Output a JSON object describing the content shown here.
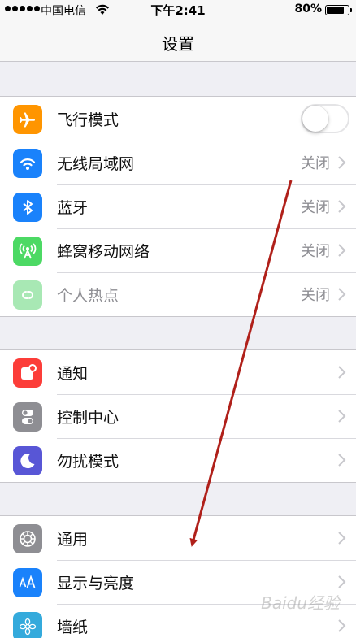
{
  "status_bar": {
    "carrier": "中国电信",
    "time": "下午2:41",
    "battery_percent": "80%",
    "battery_level": 0.8
  },
  "nav": {
    "title": "设置"
  },
  "groups": [
    {
      "items": [
        {
          "label": "飞行模式",
          "icon": "airplane-icon",
          "icon_color": "#ff9500",
          "control": "toggle",
          "toggle_on": false
        },
        {
          "label": "无线局域网",
          "icon": "wifi-icon",
          "icon_color": "#1a82fb",
          "value": "关闭"
        },
        {
          "label": "蓝牙",
          "icon": "bluetooth-icon",
          "icon_color": "#1a82fb",
          "value": "关闭"
        },
        {
          "label": "蜂窝移动网络",
          "icon": "cellular-icon",
          "icon_color": "#4cd964",
          "value": "关闭"
        },
        {
          "label": "个人热点",
          "icon": "hotspot-icon",
          "icon_color": "#a8e8b4",
          "value": "关闭",
          "disabled": true
        }
      ]
    },
    {
      "items": [
        {
          "label": "通知",
          "icon": "notifications-icon",
          "icon_color": "#fc3d39"
        },
        {
          "label": "控制中心",
          "icon": "control-center-icon",
          "icon_color": "#8e8e93"
        },
        {
          "label": "勿扰模式",
          "icon": "moon-icon",
          "icon_color": "#5856d6"
        }
      ]
    },
    {
      "items": [
        {
          "label": "通用",
          "icon": "gear-icon",
          "icon_color": "#8e8e93"
        },
        {
          "label": "显示与亮度",
          "icon": "display-brightness-icon",
          "icon_color": "#1a82fb"
        },
        {
          "label": "墙纸",
          "icon": "wallpaper-icon",
          "icon_color": "#34aadc"
        }
      ]
    }
  ],
  "annotation_color": "#b0201a",
  "watermark": "Baidu经验"
}
